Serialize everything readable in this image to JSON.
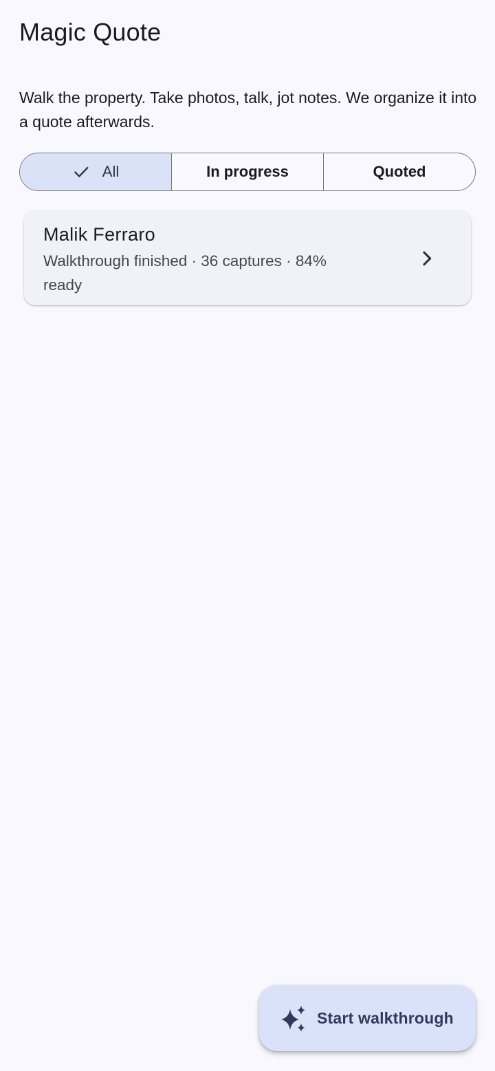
{
  "header": {
    "title": "Magic Quote"
  },
  "intro": {
    "text": "Walk the property. Take photos, talk, jot notes. We organize it into a quote afterwards."
  },
  "filters": {
    "selected": "All",
    "options": [
      {
        "label": "All"
      },
      {
        "label": "In progress"
      },
      {
        "label": "Quoted"
      }
    ],
    "selected_icon": "check-icon"
  },
  "quotes": [
    {
      "name": "Malik Ferraro",
      "summary": "Walkthrough finished · 36 captures · 84% ready",
      "icon": "chevron-right-icon"
    }
  ],
  "fab": {
    "label": "Start walkthrough",
    "icon": "sparkle-icon"
  },
  "colors": {
    "background": "#f9f8fe",
    "selected_segment": "#d9e2f7",
    "card": "#f1f2f9",
    "fab": "#d9e2f9",
    "fab_text": "#2d3a5c"
  }
}
